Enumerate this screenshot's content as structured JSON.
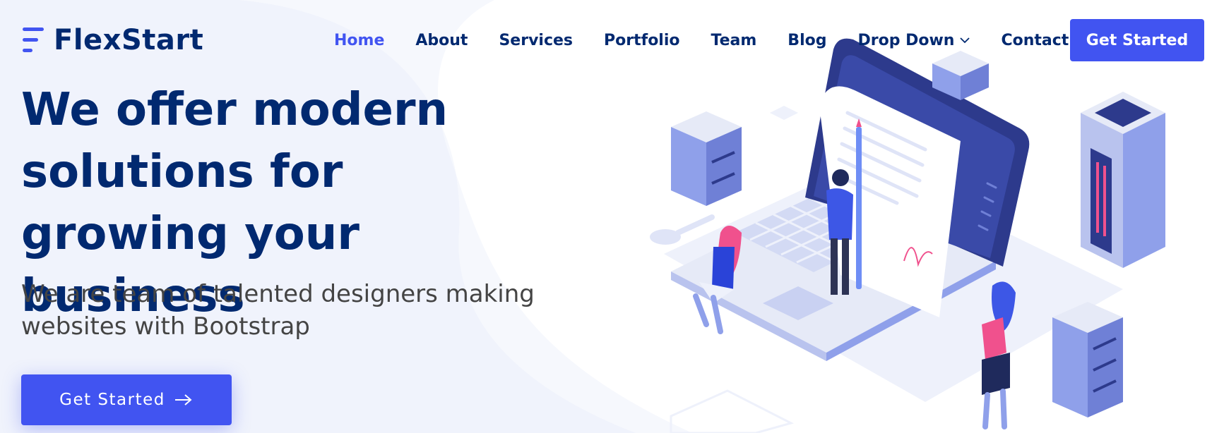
{
  "header": {
    "logo_text": "FlexStart",
    "logo_icon": "flexstart-logo-icon",
    "nav": {
      "home": "Home",
      "about": "About",
      "services": "Services",
      "portfolio": "Portfolio",
      "team": "Team",
      "blog": "Blog",
      "dropdown": "Drop Down",
      "contact": "Contact"
    },
    "cta": "Get Started"
  },
  "hero": {
    "title": "We offer modern solutions for growing your business",
    "subtitle": "We are team of talented designers making websites with Bootstrap",
    "cta": "Get Started",
    "cta_icon": "arrow-right-icon"
  },
  "colors": {
    "primary": "#4154f1",
    "heading": "#012970",
    "text": "#444444",
    "background_tint": "#eef1fb"
  }
}
